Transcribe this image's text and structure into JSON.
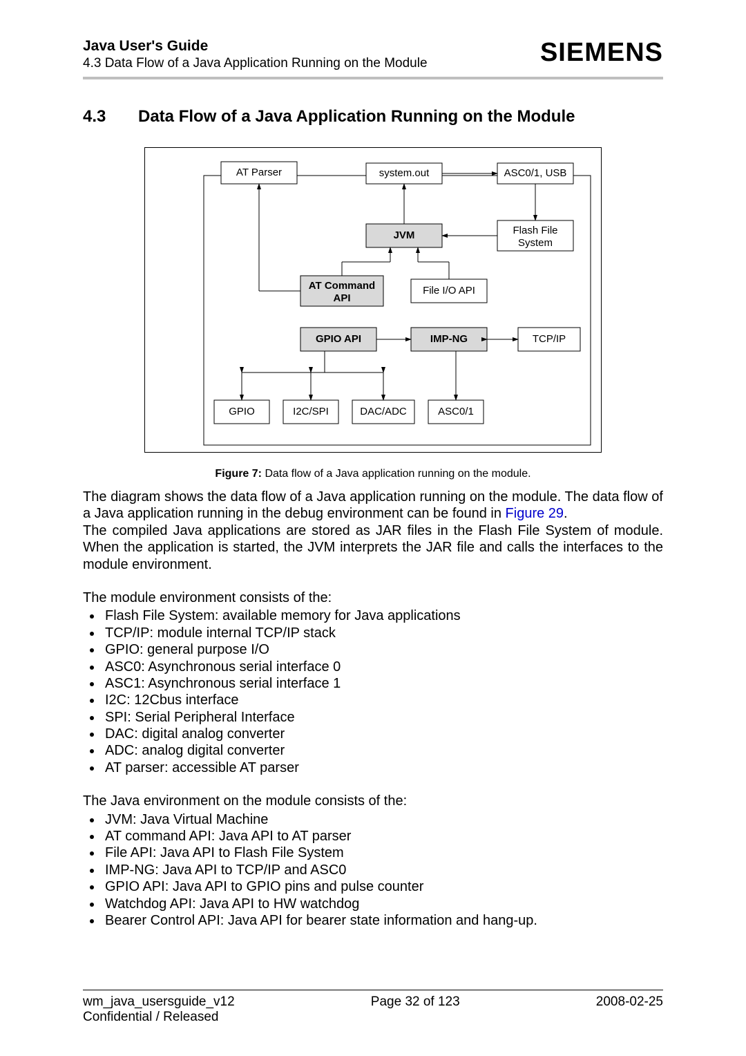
{
  "header": {
    "title": "Java User's Guide",
    "subtitle": "4.3 Data Flow of a Java Application Running on the Module",
    "brand": "SIEMENS"
  },
  "section": {
    "number": "4.3",
    "title": "Data Flow of a Java Application Running on the Module"
  },
  "diagram": {
    "nodes": {
      "at_parser": "AT Parser",
      "system_out": "system.out",
      "asc01_usb": "ASC0/1, USB",
      "jvm": "JVM",
      "flash_fs1": "Flash File",
      "flash_fs2": "System",
      "at_cmd1": "AT Command",
      "at_cmd2": "API",
      "file_io": "File I/O API",
      "gpio_api": "GPIO API",
      "imp_ng": "IMP-NG",
      "tcpip": "TCP/IP",
      "gpio": "GPIO",
      "i2c_spi": "I2C/SPI",
      "dac_adc": "DAC/ADC",
      "asc01": "ASC0/1"
    }
  },
  "fig": {
    "label": "Figure 7:",
    "caption": "Data flow of a Java application running on the module."
  },
  "para1a": "The diagram shows the data flow of a Java application running on the module. The data flow of a Java application running in the debug environment can be found in ",
  "para1_link": "Figure 29",
  "para1b": ".",
  "para2": "The compiled Java applications are stored as JAR files in the Flash File System of module. When the application is started, the JVM interprets the JAR file and calls the interfaces to the module environment.",
  "intro1": "The module environment consists of the:",
  "list1": [
    "Flash File System: available memory for Java applications",
    "TCP/IP: module internal TCP/IP stack",
    "GPIO: general purpose I/O",
    "ASC0: Asynchronous serial interface 0",
    "ASC1: Asynchronous serial interface 1",
    "I2C: 12Cbus interface",
    "SPI: Serial Peripheral Interface",
    "DAC: digital analog converter",
    "ADC: analog digital converter",
    "AT parser: accessible AT parser"
  ],
  "intro2": "The Java environment on the module consists of the:",
  "list2": [
    "JVM: Java Virtual Machine",
    "AT command API: Java API to AT parser",
    "File API: Java API to Flash File System",
    "IMP-NG: Java API to TCP/IP and ASC0",
    "GPIO API: Java API to GPIO pins and pulse counter",
    "Watchdog API: Java API to HW watchdog",
    "Bearer Control API: Java API for bearer state information and hang-up."
  ],
  "footer": {
    "doc": "wm_java_usersguide_v12",
    "page": "Page 32 of 123",
    "date": "2008-02-25",
    "class": "Confidential / Released"
  }
}
